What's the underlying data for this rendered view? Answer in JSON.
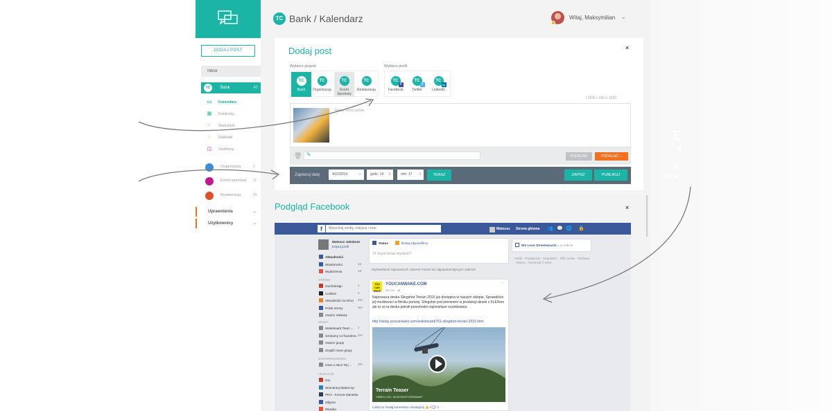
{
  "header": {
    "logo_text": "TC",
    "breadcrumb": "Bank / Kalendarz",
    "user_name": "Witaj, Maksymilian",
    "chevron": "⌄"
  },
  "sidebar": {
    "add_post": "DODAJ POST",
    "inbox": "Inbox",
    "bank": {
      "label": "Bank",
      "count": "40"
    },
    "items": [
      {
        "label": "Kalendarz",
        "icon": "calendar-icon",
        "glyph": "▭"
      },
      {
        "label": "Konkursy",
        "icon": "grid-icon",
        "glyph": "▦"
      },
      {
        "label": "Statystyki",
        "icon": "stats-icon",
        "glyph": "⟋"
      },
      {
        "label": "Zakładki",
        "icon": "star-icon",
        "glyph": "☆"
      },
      {
        "label": "Szablony",
        "icon": "template-icon",
        "glyph": "◫"
      }
    ],
    "projects": [
      {
        "label": "Organizacja",
        "count": "2",
        "color": "#3b8fd9"
      },
      {
        "label": "Event sportowy",
        "count": "11",
        "color": "#c2188a"
      },
      {
        "label": "Restauracja",
        "count": "29",
        "color": "#e0512b"
      }
    ],
    "sections": [
      {
        "label": "Uprawnienia"
      },
      {
        "label": "Użytkownicy"
      }
    ]
  },
  "add_post": {
    "title": "Dodaj post",
    "close": "×",
    "project_label": "Wybierz projekt",
    "profile_label": "Wybierz profil",
    "projects": [
      {
        "label": "Bank",
        "selected": true
      },
      {
        "label": "Organizacja",
        "selected": false
      },
      {
        "label": "Event Sportowy",
        "selected": true
      },
      {
        "label": "Restauracja",
        "selected": false
      }
    ],
    "profiles": [
      {
        "label": "Facebook",
        "badge": "f",
        "badge_color": "#3b5998"
      },
      {
        "label": "Twitter",
        "badge": "t",
        "badge_color": "#55acee"
      },
      {
        "label": "LinkedIn",
        "badge": "in",
        "badge_color": "#0077b5"
      }
    ],
    "stats": "f 2000   t 180   in 1500",
    "placeholder": "Wpisz treść posta",
    "preview_button": "PODGLĄD",
    "preview_dropdown": "PODGLĄD ⌄",
    "schedule_label": "Zaplanuj datę",
    "date": "4/22/2014",
    "hour": "godz: 14",
    "minute": "min: 17",
    "now_button": "TERAZ",
    "save_button": "ZAPISZ",
    "publish_button": "PUBLIKUJ"
  },
  "fb_preview": {
    "title": "Podgląd Facebook",
    "close": "×",
    "search_placeholder": "Wyszukaj osoby, miejsca i inne",
    "topbar_user": "Mateusz",
    "topbar_home": "Strona główna",
    "profile_name": "Mateusz Jakubsze",
    "profile_edit": "Edytuj profil",
    "nav": [
      {
        "label": "Aktualności",
        "count": "",
        "bold": true,
        "color": "#3b5998"
      },
      {
        "label": "Wiadomości",
        "count": "15",
        "color": "#3b5998"
      },
      {
        "label": "Wydarzenia",
        "count": "13",
        "color": "#d9534f"
      }
    ],
    "pages_head": "STRONY",
    "pages": [
      {
        "label": "touchdesign",
        "count": "1",
        "color": "#c0392b"
      },
      {
        "label": "Craftion",
        "count": "2",
        "color": "#222"
      },
      {
        "label": "Aktualności za stron",
        "count": "20+",
        "color": "#e67e22"
      },
      {
        "label": "Polub strony",
        "count": "20+",
        "color": "#3b5998"
      },
      {
        "label": "Utwórz reklamę",
        "count": "",
        "color": "#888"
      }
    ],
    "groups_head": "GRUPY",
    "groups": [
      {
        "label": "Wakeboard Team ...",
        "count": "2",
        "color": "#888"
      },
      {
        "label": "Szukamy co-foundera",
        "count": "20+",
        "color": "#888"
      },
      {
        "label": "Utwórz grupę",
        "count": "",
        "color": "#888"
      },
      {
        "label": "Znajdź nowe grupy",
        "count": "",
        "color": "#888"
      }
    ],
    "interests_head": "ZAINTERESOWANIA",
    "interests": [
      {
        "label": "Have a Nice Tej i...",
        "count": "20+",
        "color": "#888"
      }
    ],
    "apps_head": "APLIKACJE",
    "apps": [
      {
        "label": "Gry",
        "color": "#c0392b"
      },
      {
        "label": "Stomantuj WakeCup",
        "color": "#2980b9"
      },
      {
        "label": "PKO - Korona Maratów",
        "color": "#2c3e50"
      },
      {
        "label": "Zdjęcia",
        "color": "#3b5998"
      },
      {
        "label": "Muzyka",
        "color": "#e74c3c"
      }
    ],
    "status_tab": "Status",
    "photo_tab": "Dodaj zdjęcia/filmy",
    "status_placeholder": "O czym teraz myślisz?",
    "feed_toggle": "Wyświetlanie najnowszych zdarzeń   Powrót do najpopularniejszych zdarzeń",
    "post": {
      "author": "YOUCANWAKE.COM",
      "avatar_text": "YOU CAN WAKE",
      "time": "56 min · ⇄",
      "text": "Najnowsza deska Slingshot Terrain 2015 już dostępna w naszym sklepie. Sprawdźcie jej możliwości w filmiku poniżej. Slingshot jest pionierem w produkcji desek z FLEXem ale to co ta deska potrafi przechodzi najśmielsze oczekiwania",
      "link": "http://sklep.youcanwake.com/wakeboard/761-slingshot-terrain-2015.html",
      "video_title": "Terrain Teaser",
      "video_sub": "VIMEO  |  OD: SLINGSHOTGERMANY",
      "actions": "Lubię to!   Dodaj komentarz   Udostępnij     👍 4   💬 1"
    },
    "right_link": "We Love Streetwear!S...",
    "right_suffix": "w trakcie",
    "footer": "Polski · Prywatność · Regulamin · Pliki cookie · Reklama · Więcej · Facebook © 2014"
  },
  "ghost": {
    "line1": "E",
    "line2": "t",
    "line3": "w",
    "line4": "w e"
  }
}
